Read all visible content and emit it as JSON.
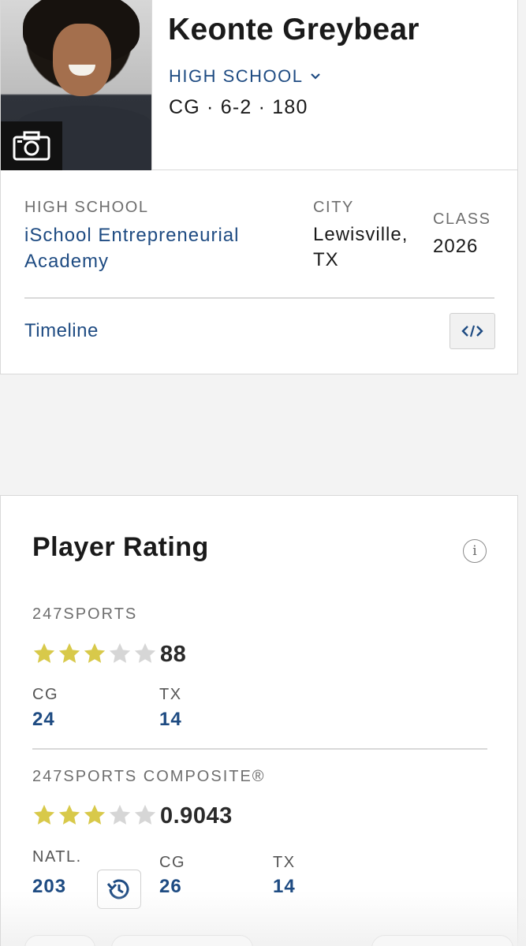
{
  "player": {
    "name": "Keonte Greybear",
    "level": "HIGH SCHOOL",
    "vitals": "CG · 6-2 · 180"
  },
  "details": {
    "high_school_label": "HIGH SCHOOL",
    "high_school_line1": "iSchool Entrepreneurial",
    "high_school_line2": "Academy",
    "city_label": "CITY",
    "city_line1": "Lewisville,",
    "city_line2": "TX",
    "class_label": "CLASS",
    "class_value": "2026",
    "timeline_label": "Timeline"
  },
  "rating": {
    "title": "Player Rating",
    "info_glyph": "i",
    "sports247": {
      "label": "247SPORTS",
      "stars": 3,
      "max_stars": 5,
      "score": "88",
      "ranks": [
        {
          "label": "CG",
          "value": "24"
        },
        {
          "label": "TX",
          "value": "14"
        }
      ]
    },
    "composite": {
      "label": "247SPORTS COMPOSITE®",
      "stars": 3,
      "max_stars": 5,
      "score": "0.9043",
      "ranks": [
        {
          "label": "NATL.",
          "value": "203"
        },
        {
          "label": "CG",
          "value": "26"
        },
        {
          "label": "TX",
          "value": "14"
        }
      ]
    }
  },
  "icons": {
    "camera": "camera-icon",
    "chevron": "chevron-down-icon",
    "embed": "code-icon",
    "info": "info-icon",
    "history": "history-icon",
    "star": "star-icon"
  },
  "colors": {
    "link": "#1e4b82",
    "star_filled": "#d8c94a",
    "star_empty": "#d6d6d6"
  }
}
